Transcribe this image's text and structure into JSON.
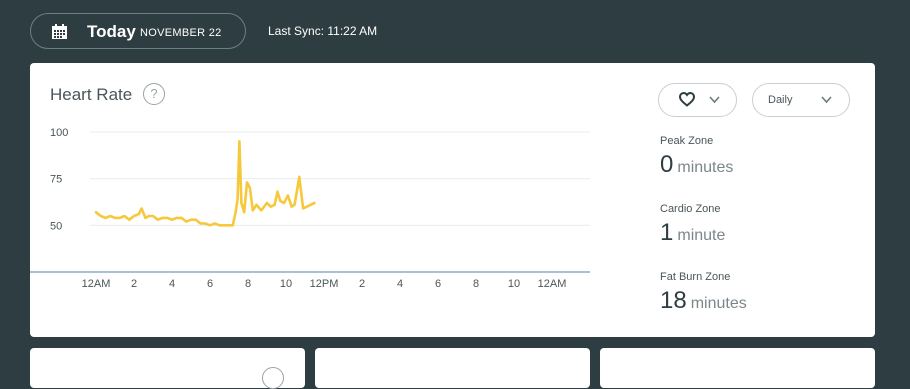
{
  "header": {
    "today_label": "Today",
    "date_label": "NOVEMBER 22",
    "sync_label": "Last Sync: 11:22 AM"
  },
  "card": {
    "title": "Heart Rate",
    "help_glyph": "?",
    "heart_dropdown_icon": "heart-icon",
    "range_dropdown_label": "Daily"
  },
  "zones": [
    {
      "label": "Peak Zone",
      "value": "0",
      "unit": "minutes"
    },
    {
      "label": "Cardio Zone",
      "value": "1",
      "unit": "minute"
    },
    {
      "label": "Fat Burn Zone",
      "value": "18",
      "unit": "minutes"
    }
  ],
  "colors": {
    "background": "#2e3d42",
    "line": "#f5c93b",
    "axis": "#a9c1d3",
    "grid": "#e9ecee"
  },
  "chart_data": {
    "type": "line",
    "title": "Heart Rate",
    "y_ticks": [
      100,
      75,
      50
    ],
    "ylim": [
      25,
      100
    ],
    "x_tick_labels": [
      "12AM",
      "2",
      "4",
      "6",
      "8",
      "10",
      "12PM",
      "2",
      "4",
      "6",
      "8",
      "10",
      "12AM"
    ],
    "xlim_hours": [
      0,
      24
    ],
    "series": [
      {
        "x": [
          0.0,
          0.25,
          0.5,
          0.75,
          1.0,
          1.25,
          1.5,
          1.75,
          2.0,
          2.25,
          2.4,
          2.6,
          2.8,
          3.0,
          3.25,
          3.5,
          3.75,
          4.0,
          4.25,
          4.5,
          4.75,
          5.0,
          5.25,
          5.5,
          5.75,
          6.0,
          6.25,
          6.5,
          6.75,
          7.0,
          7.2,
          7.35,
          7.45,
          7.55,
          7.65,
          7.8,
          7.95,
          8.1,
          8.25,
          8.45,
          8.7,
          9.0,
          9.2,
          9.4,
          9.55,
          9.7,
          9.9,
          10.1,
          10.3,
          10.45,
          10.55,
          10.7,
          10.9,
          11.1,
          11.3,
          11.5
        ],
        "y": [
          57,
          55,
          54,
          55,
          54,
          54,
          55,
          53,
          55,
          56,
          59,
          54,
          55,
          55,
          53,
          54,
          54,
          53,
          54,
          54,
          52,
          53,
          53,
          51,
          51,
          50,
          51,
          50,
          50,
          50,
          50,
          57,
          64,
          95,
          62,
          57,
          73,
          70,
          58,
          61,
          58,
          62,
          60,
          61,
          68,
          63,
          62,
          66,
          60,
          61,
          67,
          76,
          59,
          60,
          61,
          62
        ]
      }
    ],
    "grid": true
  }
}
